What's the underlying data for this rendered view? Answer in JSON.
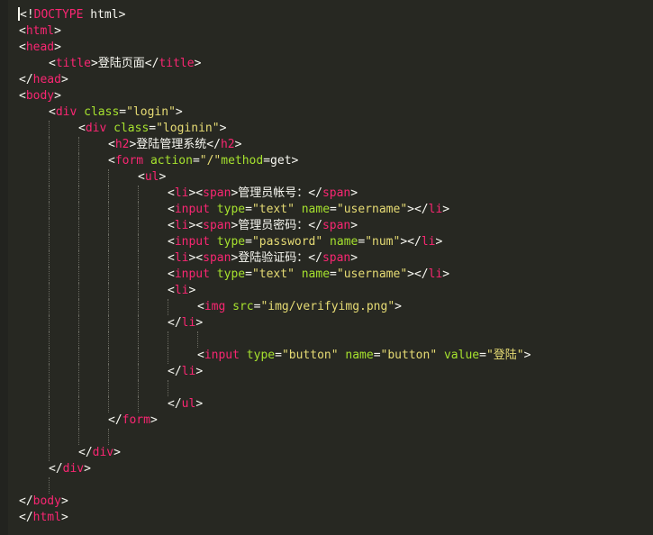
{
  "editor": {
    "background": "#272822",
    "colors": {
      "tag": "#f92672",
      "attribute": "#a6e22e",
      "string": "#e6db74",
      "text": "#f8f8f2"
    },
    "lines": [
      {
        "indent": 0,
        "tokens": [
          {
            "t": "<!",
            "c": "txt"
          },
          {
            "t": "DOCTYPE",
            "c": "tag"
          },
          {
            "t": " html>",
            "c": "txt"
          }
        ]
      },
      {
        "indent": 0,
        "tokens": [
          {
            "t": "<",
            "c": "txt"
          },
          {
            "t": "html",
            "c": "tag"
          },
          {
            "t": ">",
            "c": "txt"
          }
        ]
      },
      {
        "indent": 0,
        "tokens": [
          {
            "t": "<",
            "c": "txt"
          },
          {
            "t": "head",
            "c": "tag"
          },
          {
            "t": ">",
            "c": "txt"
          }
        ]
      },
      {
        "indent": 1,
        "tokens": [
          {
            "t": "<",
            "c": "txt"
          },
          {
            "t": "title",
            "c": "tag"
          },
          {
            "t": ">登陆页面</",
            "c": "txt"
          },
          {
            "t": "title",
            "c": "tag"
          },
          {
            "t": ">",
            "c": "txt"
          }
        ]
      },
      {
        "indent": 0,
        "tokens": [
          {
            "t": "</",
            "c": "txt"
          },
          {
            "t": "head",
            "c": "tag"
          },
          {
            "t": ">",
            "c": "txt"
          }
        ]
      },
      {
        "indent": 0,
        "tokens": [
          {
            "t": "<",
            "c": "txt"
          },
          {
            "t": "body",
            "c": "tag"
          },
          {
            "t": ">",
            "c": "txt"
          }
        ]
      },
      {
        "indent": 1,
        "tokens": [
          {
            "t": "<",
            "c": "txt"
          },
          {
            "t": "div",
            "c": "tag"
          },
          {
            "t": " ",
            "c": "txt"
          },
          {
            "t": "class",
            "c": "attr"
          },
          {
            "t": "=",
            "c": "txt"
          },
          {
            "t": "\"login\"",
            "c": "str"
          },
          {
            "t": ">",
            "c": "txt"
          }
        ]
      },
      {
        "indent": 2,
        "tokens": [
          {
            "t": "<",
            "c": "txt"
          },
          {
            "t": "div",
            "c": "tag"
          },
          {
            "t": " ",
            "c": "txt"
          },
          {
            "t": "class",
            "c": "attr"
          },
          {
            "t": "=",
            "c": "txt"
          },
          {
            "t": "\"loginin\"",
            "c": "str"
          },
          {
            "t": ">",
            "c": "txt"
          }
        ]
      },
      {
        "indent": 3,
        "tokens": [
          {
            "t": "<",
            "c": "txt"
          },
          {
            "t": "h2",
            "c": "tag"
          },
          {
            "t": ">登陆管理系统</",
            "c": "txt"
          },
          {
            "t": "h2",
            "c": "tag"
          },
          {
            "t": ">",
            "c": "txt"
          }
        ]
      },
      {
        "indent": 3,
        "tokens": [
          {
            "t": "<",
            "c": "txt"
          },
          {
            "t": "form",
            "c": "tag"
          },
          {
            "t": " ",
            "c": "txt"
          },
          {
            "t": "action",
            "c": "attr"
          },
          {
            "t": "=",
            "c": "txt"
          },
          {
            "t": "\"/\"",
            "c": "str"
          },
          {
            "t": "method",
            "c": "attr"
          },
          {
            "t": "=get>",
            "c": "txt"
          }
        ]
      },
      {
        "indent": 4,
        "tokens": [
          {
            "t": "<",
            "c": "txt"
          },
          {
            "t": "ul",
            "c": "tag"
          },
          {
            "t": ">",
            "c": "txt"
          }
        ]
      },
      {
        "indent": 5,
        "tokens": [
          {
            "t": "<",
            "c": "txt"
          },
          {
            "t": "li",
            "c": "tag"
          },
          {
            "t": "><",
            "c": "txt"
          },
          {
            "t": "span",
            "c": "tag"
          },
          {
            "t": ">管理员帐号：</",
            "c": "txt"
          },
          {
            "t": "span",
            "c": "tag"
          },
          {
            "t": ">",
            "c": "txt"
          }
        ]
      },
      {
        "indent": 5,
        "tokens": [
          {
            "t": "<",
            "c": "txt"
          },
          {
            "t": "input",
            "c": "tag"
          },
          {
            "t": " ",
            "c": "txt"
          },
          {
            "t": "type",
            "c": "attr"
          },
          {
            "t": "=",
            "c": "txt"
          },
          {
            "t": "\"text\"",
            "c": "str"
          },
          {
            "t": " ",
            "c": "txt"
          },
          {
            "t": "name",
            "c": "attr"
          },
          {
            "t": "=",
            "c": "txt"
          },
          {
            "t": "\"username\"",
            "c": "str"
          },
          {
            "t": "></",
            "c": "txt"
          },
          {
            "t": "li",
            "c": "tag"
          },
          {
            "t": ">",
            "c": "txt"
          }
        ]
      },
      {
        "indent": 5,
        "tokens": [
          {
            "t": "<",
            "c": "txt"
          },
          {
            "t": "li",
            "c": "tag"
          },
          {
            "t": "><",
            "c": "txt"
          },
          {
            "t": "span",
            "c": "tag"
          },
          {
            "t": ">管理员密码：</",
            "c": "txt"
          },
          {
            "t": "span",
            "c": "tag"
          },
          {
            "t": ">",
            "c": "txt"
          }
        ]
      },
      {
        "indent": 5,
        "tokens": [
          {
            "t": "<",
            "c": "txt"
          },
          {
            "t": "input",
            "c": "tag"
          },
          {
            "t": " ",
            "c": "txt"
          },
          {
            "t": "type",
            "c": "attr"
          },
          {
            "t": "=",
            "c": "txt"
          },
          {
            "t": "\"password\"",
            "c": "str"
          },
          {
            "t": " ",
            "c": "txt"
          },
          {
            "t": "name",
            "c": "attr"
          },
          {
            "t": "=",
            "c": "txt"
          },
          {
            "t": "\"num\"",
            "c": "str"
          },
          {
            "t": "></",
            "c": "txt"
          },
          {
            "t": "li",
            "c": "tag"
          },
          {
            "t": ">",
            "c": "txt"
          }
        ]
      },
      {
        "indent": 5,
        "tokens": [
          {
            "t": "<",
            "c": "txt"
          },
          {
            "t": "li",
            "c": "tag"
          },
          {
            "t": "><",
            "c": "txt"
          },
          {
            "t": "span",
            "c": "tag"
          },
          {
            "t": ">登陆验证码：</",
            "c": "txt"
          },
          {
            "t": "span",
            "c": "tag"
          },
          {
            "t": ">",
            "c": "txt"
          }
        ]
      },
      {
        "indent": 5,
        "tokens": [
          {
            "t": "<",
            "c": "txt"
          },
          {
            "t": "input",
            "c": "tag"
          },
          {
            "t": " ",
            "c": "txt"
          },
          {
            "t": "type",
            "c": "attr"
          },
          {
            "t": "=",
            "c": "txt"
          },
          {
            "t": "\"text\"",
            "c": "str"
          },
          {
            "t": " ",
            "c": "txt"
          },
          {
            "t": "name",
            "c": "attr"
          },
          {
            "t": "=",
            "c": "txt"
          },
          {
            "t": "\"username\"",
            "c": "str"
          },
          {
            "t": "></",
            "c": "txt"
          },
          {
            "t": "li",
            "c": "tag"
          },
          {
            "t": ">",
            "c": "txt"
          }
        ]
      },
      {
        "indent": 5,
        "tokens": [
          {
            "t": "<",
            "c": "txt"
          },
          {
            "t": "li",
            "c": "tag"
          },
          {
            "t": ">",
            "c": "txt"
          }
        ]
      },
      {
        "indent": 6,
        "tokens": [
          {
            "t": "<",
            "c": "txt"
          },
          {
            "t": "img",
            "c": "tag"
          },
          {
            "t": " ",
            "c": "txt"
          },
          {
            "t": "src",
            "c": "attr"
          },
          {
            "t": "=",
            "c": "txt"
          },
          {
            "t": "\"img/verifyimg.png\"",
            "c": "str"
          },
          {
            "t": ">",
            "c": "txt"
          }
        ]
      },
      {
        "indent": 5,
        "tokens": [
          {
            "t": "</",
            "c": "txt"
          },
          {
            "t": "li",
            "c": "tag"
          },
          {
            "t": ">",
            "c": "txt"
          }
        ]
      },
      {
        "indent": 0,
        "tokens": []
      },
      {
        "indent": 6,
        "tokens": [
          {
            "t": "<",
            "c": "txt"
          },
          {
            "t": "input",
            "c": "tag"
          },
          {
            "t": " ",
            "c": "txt"
          },
          {
            "t": "type",
            "c": "attr"
          },
          {
            "t": "=",
            "c": "txt"
          },
          {
            "t": "\"button\"",
            "c": "str"
          },
          {
            "t": " ",
            "c": "txt"
          },
          {
            "t": "name",
            "c": "attr"
          },
          {
            "t": "=",
            "c": "txt"
          },
          {
            "t": "\"button\"",
            "c": "str"
          },
          {
            "t": " ",
            "c": "txt"
          },
          {
            "t": "value",
            "c": "attr"
          },
          {
            "t": "=",
            "c": "txt"
          },
          {
            "t": "\"登陆\"",
            "c": "str"
          },
          {
            "t": ">",
            "c": "txt"
          }
        ]
      },
      {
        "indent": 5,
        "tokens": [
          {
            "t": "</",
            "c": "txt"
          },
          {
            "t": "li",
            "c": "tag"
          },
          {
            "t": ">",
            "c": "txt"
          }
        ]
      },
      {
        "indent": 0,
        "tokens": []
      },
      {
        "indent": 5,
        "tokens": [
          {
            "t": "</",
            "c": "txt"
          },
          {
            "t": "ul",
            "c": "tag"
          },
          {
            "t": ">",
            "c": "txt"
          }
        ]
      },
      {
        "indent": 3,
        "tokens": [
          {
            "t": "</",
            "c": "txt"
          },
          {
            "t": "form",
            "c": "tag"
          },
          {
            "t": ">",
            "c": "txt"
          }
        ]
      },
      {
        "indent": 0,
        "tokens": []
      },
      {
        "indent": 2,
        "tokens": [
          {
            "t": "</",
            "c": "txt"
          },
          {
            "t": "div",
            "c": "tag"
          },
          {
            "t": ">",
            "c": "txt"
          }
        ]
      },
      {
        "indent": 1,
        "tokens": [
          {
            "t": "</",
            "c": "txt"
          },
          {
            "t": "div",
            "c": "tag"
          },
          {
            "t": ">",
            "c": "txt"
          }
        ]
      },
      {
        "indent": 0,
        "tokens": []
      },
      {
        "indent": 0,
        "tokens": [
          {
            "t": "</",
            "c": "txt"
          },
          {
            "t": "body",
            "c": "tag"
          },
          {
            "t": ">",
            "c": "txt"
          }
        ]
      },
      {
        "indent": 0,
        "tokens": [
          {
            "t": "</",
            "c": "txt"
          },
          {
            "t": "html",
            "c": "tag"
          },
          {
            "t": ">",
            "c": "txt"
          }
        ]
      }
    ]
  }
}
